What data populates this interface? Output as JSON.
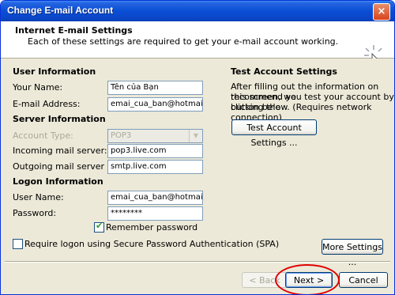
{
  "window": {
    "title": "Change E-mail Account",
    "close_glyph": "×"
  },
  "header": {
    "title": "Internet E-mail Settings",
    "subtitle": "Each of these settings are required to get your e-mail account working."
  },
  "user_info": {
    "section": "User Information",
    "name_label": "Your Name:",
    "name_value": "Tên của Bạn",
    "email_label": "E-mail Address:",
    "email_value": "emai_cua_ban@hotmail.com"
  },
  "server_info": {
    "section": "Server Information",
    "account_type_label": "Account Type:",
    "account_type_value": "POP3",
    "incoming_label": "Incoming mail server:",
    "incoming_value": "pop3.live.com",
    "outgoing_label": "Outgoing mail server (SMTP):",
    "outgoing_value": "smtp.live.com"
  },
  "logon_info": {
    "section": "Logon Information",
    "user_label": "User Name:",
    "user_value": "emai_cua_ban@hotmail.com",
    "password_label": "Password:",
    "password_value": "********",
    "remember_label": "Remember password",
    "remember_checked": true,
    "spa_label": "Require logon using Secure Password Authentication (SPA)",
    "spa_checked": false
  },
  "test": {
    "section": "Test Account Settings",
    "line1": "After filling out the information on this screen, we",
    "line2": "recommend you test your account by clicking the",
    "line3": "button below. (Requires network connection)",
    "button": "Test Account Settings ..."
  },
  "buttons": {
    "more_settings": "More Settings ...",
    "back": "< Back",
    "next": "Next >",
    "cancel": "Cancel"
  },
  "icons": {
    "header": "sparkle-cursor-icon",
    "combo": "chevron-down-icon"
  },
  "colors": {
    "titlebar": "#0a4ed6",
    "highlight": "#e00000",
    "dialog_bg": "#ece9d8"
  }
}
